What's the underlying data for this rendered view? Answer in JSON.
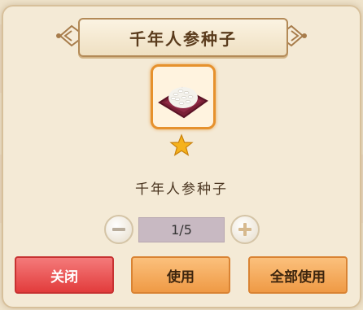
{
  "dialog": {
    "title": "千年人参种子",
    "item_name": "千年人参种子",
    "item_icon": "rice-seed-bowl-icon",
    "rarity_stars": 1,
    "quantity": "1/5"
  },
  "buttons": {
    "close_label": "关闭",
    "use_label": "使用",
    "use_all_label": "全部使用"
  },
  "colors": {
    "close_button": "#e23c3c",
    "use_button": "#ef9a45",
    "item_frame": "#e6912d",
    "star": "#f5b21c"
  }
}
